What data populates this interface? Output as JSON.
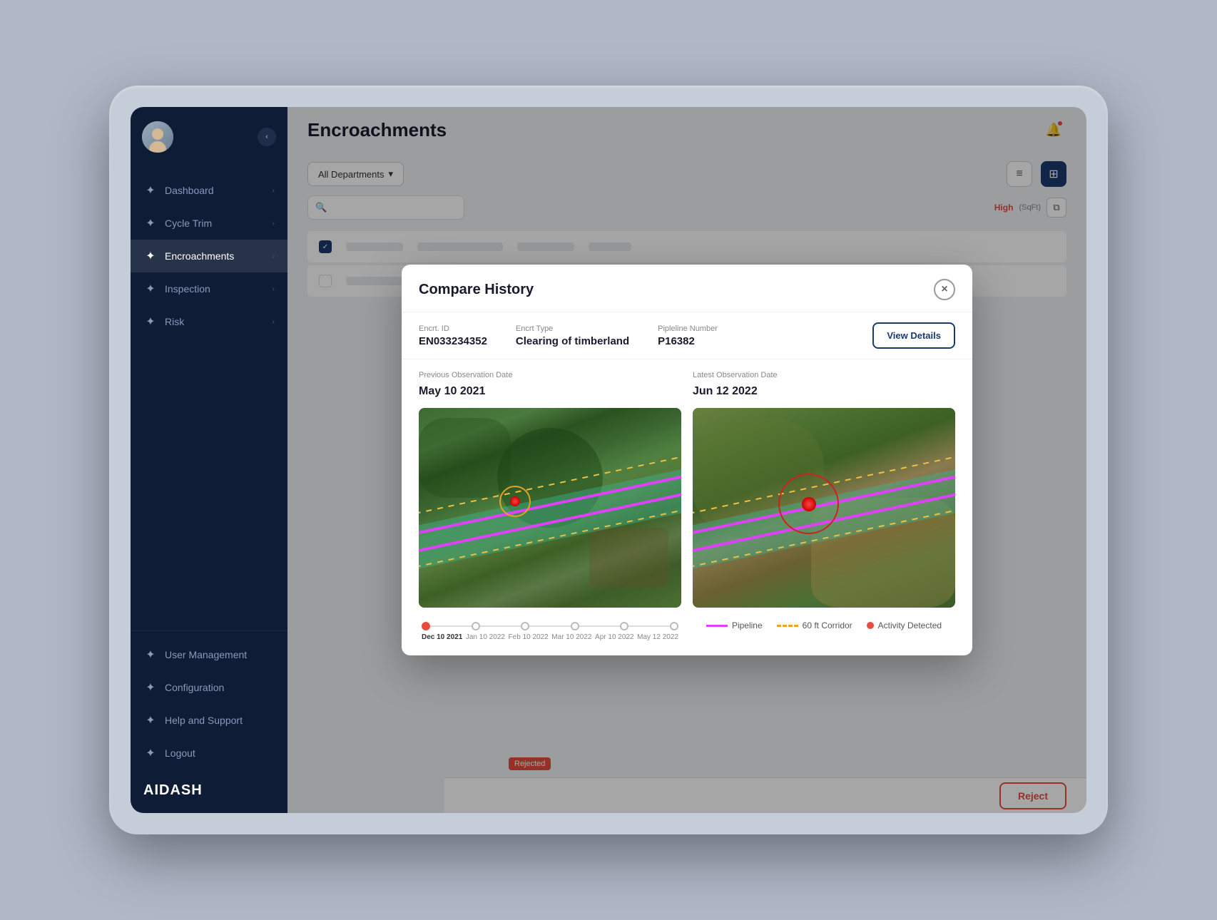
{
  "app": {
    "title": "AiDash",
    "logo": "AIDASH"
  },
  "page": {
    "title": "Encroachments"
  },
  "sidebar": {
    "items": [
      {
        "id": "dashboard",
        "label": "Dashboard",
        "icon": "⊞",
        "active": false
      },
      {
        "id": "cycle-trim",
        "label": "Cycle Trim",
        "icon": "✦",
        "active": false
      },
      {
        "id": "encroachments",
        "label": "Encroachments",
        "icon": "✦",
        "active": true
      },
      {
        "id": "inspection",
        "label": "Inspection",
        "icon": "✦",
        "active": false
      },
      {
        "id": "risk",
        "label": "Risk",
        "icon": "✦",
        "active": false
      }
    ],
    "bottom_items": [
      {
        "id": "user-management",
        "label": "User Management",
        "icon": "✦"
      },
      {
        "id": "configuration",
        "label": "Configuration",
        "icon": "✦"
      },
      {
        "id": "help-support",
        "label": "Help and Support",
        "icon": "✦"
      },
      {
        "id": "logout",
        "label": "Logout",
        "icon": "✦"
      }
    ]
  },
  "toolbar": {
    "filter_label": "All Departments",
    "list_icon": "list",
    "map_icon": "map"
  },
  "modal": {
    "title": "Compare History",
    "close_label": "×",
    "encrt_id_label": "Encrt. ID",
    "encrt_id_value": "EN033234352",
    "encrt_type_label": "Encrt Type",
    "encrt_type_value": "Clearing of timberland",
    "pipeline_number_label": "Pipleline Number",
    "pipeline_number_value": "P16382",
    "view_details_label": "View Details",
    "previous": {
      "obs_label": "Previous Observation Date",
      "obs_date": "May 10 2021"
    },
    "latest": {
      "obs_label": "Latest Observation Date",
      "obs_date": "Jun 12 2022"
    },
    "timeline": {
      "dates": [
        "Dec 10 2021",
        "Jan 10 2022",
        "Feb 10 2022",
        "Mar 10 2022",
        "Apr 10 2022",
        "May 12 2022"
      ]
    },
    "legend": {
      "pipeline_label": "Pipeline",
      "corridor_label": "60 ft Corridor",
      "activity_label": "Activity Detected"
    }
  },
  "table_bg": {
    "risk_high": "High",
    "sqft_label": "(SqFt)",
    "reject_btn": "Reject",
    "rejected_badge": "Rejected"
  }
}
